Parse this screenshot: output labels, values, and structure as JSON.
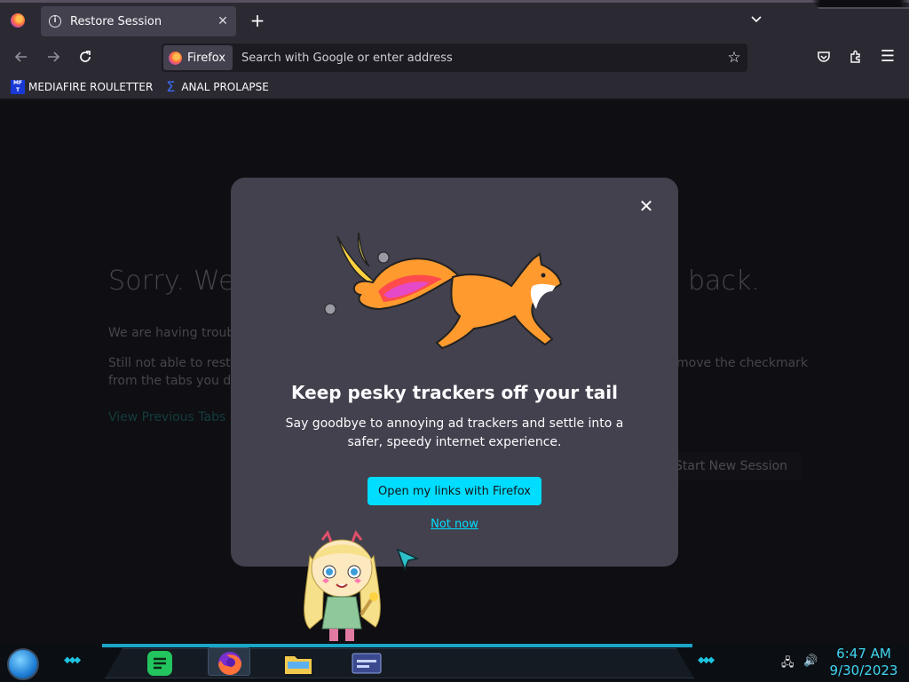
{
  "browser": {
    "tab": {
      "title": "Restore Session"
    },
    "urlbar": {
      "identity_label": "Firefox",
      "placeholder": "Search with Google or enter address"
    },
    "bookmarks": [
      {
        "label": "MEDIAFIRE ROULETTER",
        "favicon_text": "MF T"
      },
      {
        "label": "ANAL PROLAPSE"
      }
    ]
  },
  "background_page": {
    "title_start": "Sorry. We’",
    "title_end": "back.",
    "line1": "We are having troubl",
    "line2": "Still not able to resto",
    "line2_end": "move the checkmark",
    "line3": "from the tabs you do",
    "view_previous_tabs": "View Previous Tabs",
    "start_new_session": "Start New Session"
  },
  "modal": {
    "title": "Keep pesky trackers off your tail",
    "description": "Say goodbye to annoying ad trackers and settle into a safer, speedy internet experience.",
    "primary_button": "Open my links with Firefox",
    "secondary_link": "Not now"
  },
  "taskbar": {
    "clock_time": "6:47 AM",
    "clock_date": "9/30/2023"
  },
  "colors": {
    "accent": "#00ddff",
    "modal_bg": "#42414d",
    "page_bg": "#1c1b22",
    "clock": "#3fd6f0"
  },
  "icons": [
    "firefox-icon",
    "info-icon",
    "close-icon",
    "plus-icon",
    "chevron-down-icon",
    "back-icon",
    "forward-icon",
    "reload-icon",
    "star-icon",
    "pocket-icon",
    "extensions-icon",
    "menu-icon",
    "fox-illustration",
    "start-orb-icon",
    "network-icon",
    "volume-icon"
  ]
}
